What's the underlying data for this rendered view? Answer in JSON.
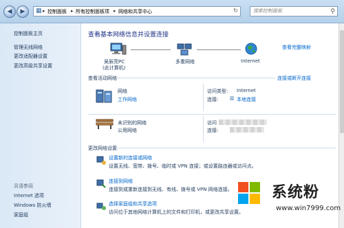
{
  "address_bar": {
    "segments": [
      "控制面板",
      "所有控制面板项",
      "网络和共享中心"
    ],
    "search_placeholder": "搜索控制面板"
  },
  "sidebar": {
    "home": "控制面板主页",
    "items": [
      "管理无线网络",
      "更改适配器设置",
      "更改高级共享设置"
    ],
    "see_also_title": "另请参阅",
    "see_also": [
      "Internet 选项",
      "Windows 防火墙",
      "家庭组"
    ]
  },
  "main": {
    "title": "查看基本网络信息并设置连接",
    "view_full_map": "查看完整映射",
    "map_nodes": [
      {
        "label": "吴辰亮PC",
        "sublabel": "(此计算机)"
      },
      {
        "label": "多重网络",
        "sublabel": ""
      },
      {
        "label": "Internet",
        "sublabel": ""
      }
    ],
    "active_section_title": "查看活动网络",
    "connect_disconnect": "连接或断开连接",
    "networks": [
      {
        "name": "网络",
        "type": "工作网络",
        "access_type_label": "访问类型:",
        "access_type_value": "Internet",
        "connection_label": "连接:",
        "connection_value": "本地连接"
      },
      {
        "name": "未识别的网络",
        "type": "公用网络",
        "access_type_label": "访问",
        "access_type_value": "",
        "connection_label": "连接:",
        "connection_value": ""
      }
    ],
    "change_section_title": "更改网络设置",
    "tasks": [
      {
        "title": "设置新的连接或网络",
        "desc": "设置无线、宽带、拨号、临时或 VPN 连接；或设置路由器或访问点。"
      },
      {
        "title": "连接到网络",
        "desc": "连接到或重新连接到无线、有线、拨号或 VPN 网络连接。"
      },
      {
        "title": "选择家庭组和共享选项",
        "desc": "访问位于其他网络计算机上的文件和打印机，或更改共享设置。"
      }
    ]
  },
  "watermark": {
    "brand": "系统粉",
    "url": "www.win7999.com"
  },
  "colors": {
    "link": "#0066cc",
    "heading": "#1e3287",
    "sidebar_bg": "#dbe8f6",
    "text": "#1e395b"
  }
}
